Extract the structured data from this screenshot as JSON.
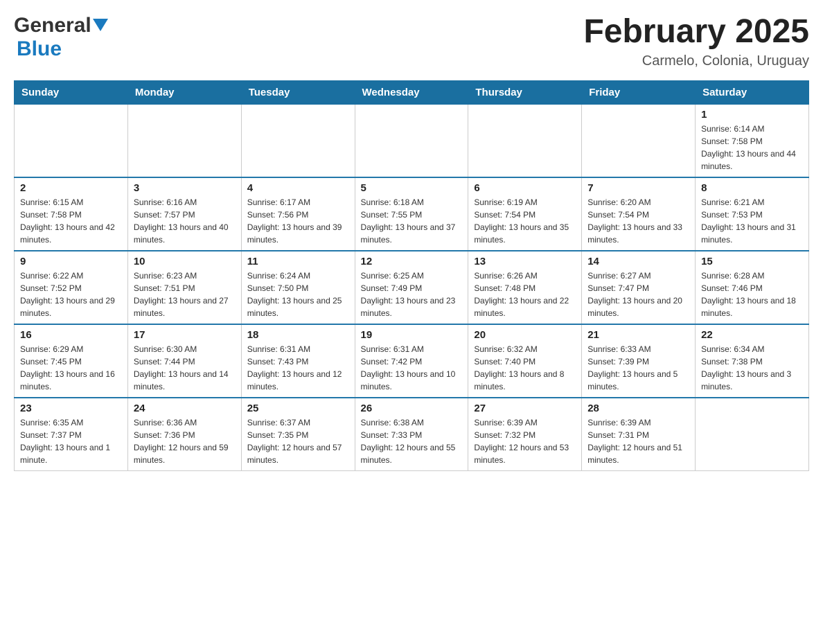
{
  "header": {
    "logo_general": "General",
    "logo_blue": "Blue",
    "month_title": "February 2025",
    "location": "Carmelo, Colonia, Uruguay"
  },
  "days_of_week": [
    "Sunday",
    "Monday",
    "Tuesday",
    "Wednesday",
    "Thursday",
    "Friday",
    "Saturday"
  ],
  "weeks": [
    [
      {
        "day": "",
        "info": ""
      },
      {
        "day": "",
        "info": ""
      },
      {
        "day": "",
        "info": ""
      },
      {
        "day": "",
        "info": ""
      },
      {
        "day": "",
        "info": ""
      },
      {
        "day": "",
        "info": ""
      },
      {
        "day": "1",
        "info": "Sunrise: 6:14 AM\nSunset: 7:58 PM\nDaylight: 13 hours and 44 minutes."
      }
    ],
    [
      {
        "day": "2",
        "info": "Sunrise: 6:15 AM\nSunset: 7:58 PM\nDaylight: 13 hours and 42 minutes."
      },
      {
        "day": "3",
        "info": "Sunrise: 6:16 AM\nSunset: 7:57 PM\nDaylight: 13 hours and 40 minutes."
      },
      {
        "day": "4",
        "info": "Sunrise: 6:17 AM\nSunset: 7:56 PM\nDaylight: 13 hours and 39 minutes."
      },
      {
        "day": "5",
        "info": "Sunrise: 6:18 AM\nSunset: 7:55 PM\nDaylight: 13 hours and 37 minutes."
      },
      {
        "day": "6",
        "info": "Sunrise: 6:19 AM\nSunset: 7:54 PM\nDaylight: 13 hours and 35 minutes."
      },
      {
        "day": "7",
        "info": "Sunrise: 6:20 AM\nSunset: 7:54 PM\nDaylight: 13 hours and 33 minutes."
      },
      {
        "day": "8",
        "info": "Sunrise: 6:21 AM\nSunset: 7:53 PM\nDaylight: 13 hours and 31 minutes."
      }
    ],
    [
      {
        "day": "9",
        "info": "Sunrise: 6:22 AM\nSunset: 7:52 PM\nDaylight: 13 hours and 29 minutes."
      },
      {
        "day": "10",
        "info": "Sunrise: 6:23 AM\nSunset: 7:51 PM\nDaylight: 13 hours and 27 minutes."
      },
      {
        "day": "11",
        "info": "Sunrise: 6:24 AM\nSunset: 7:50 PM\nDaylight: 13 hours and 25 minutes."
      },
      {
        "day": "12",
        "info": "Sunrise: 6:25 AM\nSunset: 7:49 PM\nDaylight: 13 hours and 23 minutes."
      },
      {
        "day": "13",
        "info": "Sunrise: 6:26 AM\nSunset: 7:48 PM\nDaylight: 13 hours and 22 minutes."
      },
      {
        "day": "14",
        "info": "Sunrise: 6:27 AM\nSunset: 7:47 PM\nDaylight: 13 hours and 20 minutes."
      },
      {
        "day": "15",
        "info": "Sunrise: 6:28 AM\nSunset: 7:46 PM\nDaylight: 13 hours and 18 minutes."
      }
    ],
    [
      {
        "day": "16",
        "info": "Sunrise: 6:29 AM\nSunset: 7:45 PM\nDaylight: 13 hours and 16 minutes."
      },
      {
        "day": "17",
        "info": "Sunrise: 6:30 AM\nSunset: 7:44 PM\nDaylight: 13 hours and 14 minutes."
      },
      {
        "day": "18",
        "info": "Sunrise: 6:31 AM\nSunset: 7:43 PM\nDaylight: 13 hours and 12 minutes."
      },
      {
        "day": "19",
        "info": "Sunrise: 6:31 AM\nSunset: 7:42 PM\nDaylight: 13 hours and 10 minutes."
      },
      {
        "day": "20",
        "info": "Sunrise: 6:32 AM\nSunset: 7:40 PM\nDaylight: 13 hours and 8 minutes."
      },
      {
        "day": "21",
        "info": "Sunrise: 6:33 AM\nSunset: 7:39 PM\nDaylight: 13 hours and 5 minutes."
      },
      {
        "day": "22",
        "info": "Sunrise: 6:34 AM\nSunset: 7:38 PM\nDaylight: 13 hours and 3 minutes."
      }
    ],
    [
      {
        "day": "23",
        "info": "Sunrise: 6:35 AM\nSunset: 7:37 PM\nDaylight: 13 hours and 1 minute."
      },
      {
        "day": "24",
        "info": "Sunrise: 6:36 AM\nSunset: 7:36 PM\nDaylight: 12 hours and 59 minutes."
      },
      {
        "day": "25",
        "info": "Sunrise: 6:37 AM\nSunset: 7:35 PM\nDaylight: 12 hours and 57 minutes."
      },
      {
        "day": "26",
        "info": "Sunrise: 6:38 AM\nSunset: 7:33 PM\nDaylight: 12 hours and 55 minutes."
      },
      {
        "day": "27",
        "info": "Sunrise: 6:39 AM\nSunset: 7:32 PM\nDaylight: 12 hours and 53 minutes."
      },
      {
        "day": "28",
        "info": "Sunrise: 6:39 AM\nSunset: 7:31 PM\nDaylight: 12 hours and 51 minutes."
      },
      {
        "day": "",
        "info": ""
      }
    ]
  ]
}
